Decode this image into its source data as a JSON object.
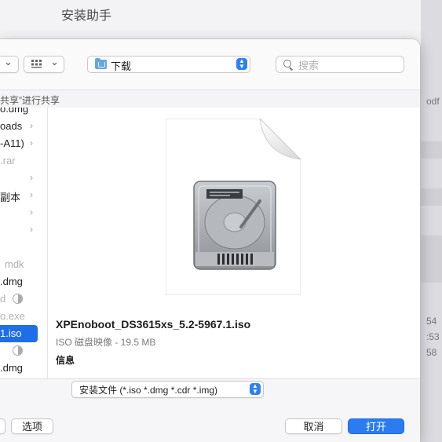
{
  "window": {
    "title": "安装助手"
  },
  "background_right": {
    "texts": [
      "odf",
      "54",
      ":53",
      "58"
    ]
  },
  "toolbar": {
    "view_chevron": "⌄",
    "group_chevron": "⌄",
    "location": "下载",
    "search_placeholder": "搜索"
  },
  "sharing_notice": "共享”进行共享",
  "file_list": [
    {
      "label": "o.dmg",
      "dim": false,
      "chevron": false
    },
    {
      "label": "oads",
      "dim": false,
      "chevron": true
    },
    {
      "label": "-A11)",
      "dim": false,
      "chevron": true
    },
    {
      "label": ".rar",
      "dim": true,
      "chevron": false
    },
    {
      "label": "",
      "dim": false,
      "chevron": true
    },
    {
      "label": "副本",
      "dim": false,
      "chevron": true
    },
    {
      "label": "",
      "dim": false,
      "chevron": true
    },
    {
      "label": "",
      "dim": false,
      "chevron": true
    },
    {
      "label": "",
      "dim": false,
      "chevron": false
    },
    {
      "label": "mdk",
      "dim": true,
      "chevron": false
    },
    {
      "label": ".dmg",
      "dim": false,
      "chevron": false
    },
    {
      "label": "d",
      "dim": true,
      "chevron": false,
      "sync": true
    },
    {
      "label": "o.exe",
      "dim": true,
      "chevron": false
    },
    {
      "label": "1.iso",
      "dim": false,
      "chevron": false,
      "selected": true
    },
    {
      "label": "",
      "dim": false,
      "chevron": false,
      "sync": true
    },
    {
      "label": ".dmg",
      "dim": false,
      "chevron": false
    }
  ],
  "preview": {
    "file_name": "XPEnoboot_DS3615xs_5.2-5967.1.iso",
    "meta": "ISO 磁盘映像 - 19.5 MB",
    "info_heading": "信息"
  },
  "bottom": {
    "file_type_filter": "安装文件 (*.iso *.dmg *.cdr *.img)",
    "options_label": "选项",
    "cancel_label": "取消",
    "open_label": "打开"
  },
  "colors": {
    "accent": "#2a7cf0",
    "selection": "#1f6ee8",
    "folder": "#66a8de"
  }
}
